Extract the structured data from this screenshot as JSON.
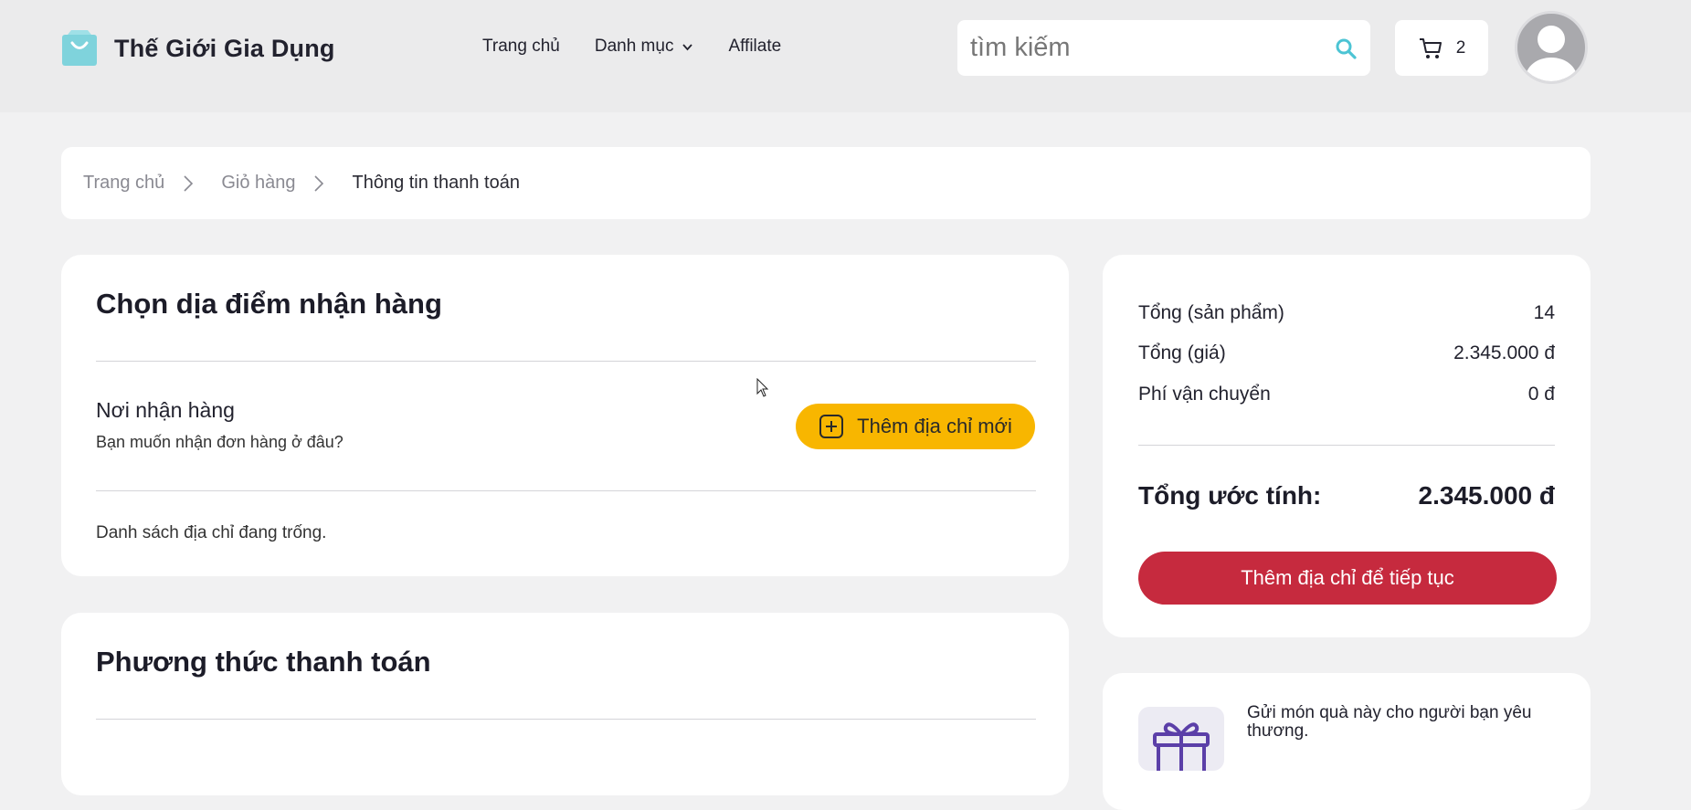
{
  "colors": {
    "brand": "#7fd3dc",
    "accent_yellow": "#f8b600",
    "accent_red": "#c62a3e",
    "search_icon": "#4cc4d4"
  },
  "header": {
    "logo_text": "Thế Giới Gia Dụng",
    "nav": [
      "Trang chủ",
      "Danh mục",
      "Affilate"
    ],
    "search_placeholder": "tìm kiếm",
    "cart_count": "2"
  },
  "breadcrumb": [
    "Trang chủ",
    "Giỏ hàng",
    "Thông tin thanh toán"
  ],
  "address": {
    "title": "Chọn dịa điểm nhận hàng",
    "receive_title": "Nơi nhận hàng",
    "receive_sub": "Bạn muốn nhận đơn hàng ở đâu?",
    "add_button": "Thêm địa chỉ mới",
    "empty": "Danh sách địa chỉ đang trống."
  },
  "payment": {
    "title": "Phương thức thanh toán"
  },
  "summary": {
    "rows": [
      {
        "label": "Tổng (sản phẩm)",
        "value": "14"
      },
      {
        "label": "Tổng (giá)",
        "value": "2.345.000 đ"
      },
      {
        "label": "Phí vận chuyển",
        "value": "0 đ"
      }
    ],
    "total_label": "Tổng ước tính:",
    "total_value": "2.345.000 đ",
    "continue_button": "Thêm địa chỉ để tiếp tục"
  },
  "gift": {
    "text": "Gửi món quà này cho người bạn yêu thương."
  }
}
